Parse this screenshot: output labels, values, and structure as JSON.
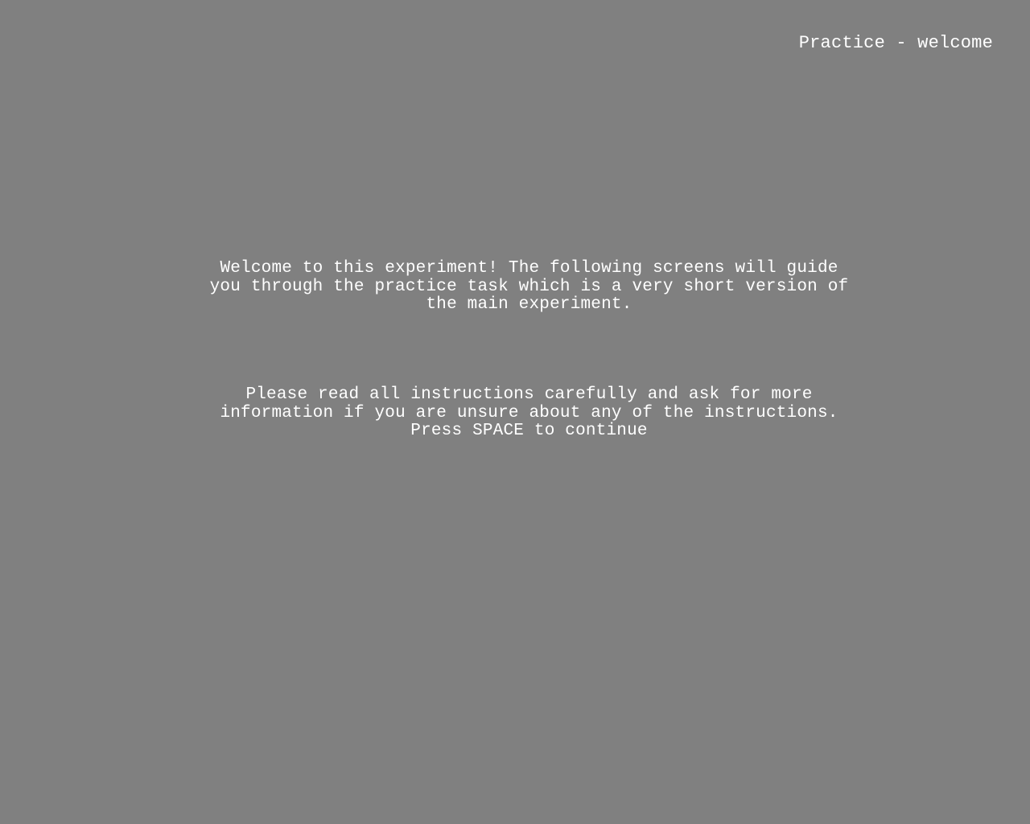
{
  "screen": {
    "phase_label": "Practice - welcome",
    "welcome_text": "Welcome to this experiment! The following screens will guide\nyou through the practice task which is a very short version of\nthe main experiment.",
    "instructions_text": "Please read all instructions carefully and ask for more\ninformation if you are unsure about any of the instructions.\nPress SPACE to continue"
  },
  "colors": {
    "background": "#808080",
    "text": "#ffffff"
  }
}
